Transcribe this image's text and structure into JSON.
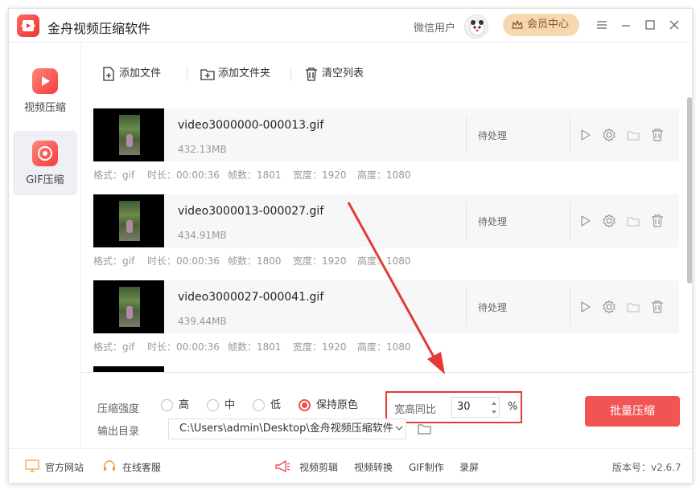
{
  "app": {
    "title": "金舟视频压缩软件",
    "user_name": "微信用户",
    "vip_label": "会员中心"
  },
  "sidebar": {
    "items": [
      {
        "label": "视频压缩",
        "icon": "video-play-icon",
        "active": false
      },
      {
        "label": "GIF压缩",
        "icon": "gif-icon",
        "active": true
      }
    ]
  },
  "toolbar": {
    "add_file": "添加文件",
    "add_folder": "添加文件夹",
    "clear_list": "清空列表"
  },
  "files": [
    {
      "name": "video3000000-000013.gif",
      "size": "432.13MB",
      "status": "待处理",
      "format": "格式：gif",
      "duration": "时长：00:00:36",
      "frames": "帧数：1801",
      "width": "宽度：1920",
      "height": "高度：1080"
    },
    {
      "name": "video3000013-000027.gif",
      "size": "434.91MB",
      "status": "待处理",
      "format": "格式：gif",
      "duration": "时长：00:00:36",
      "frames": "帧数：1800",
      "width": "宽度：1920",
      "height": "高度：1080"
    },
    {
      "name": "video3000027-000041.gif",
      "size": "439.44MB",
      "status": "待处理",
      "format": "格式：gif",
      "duration": "时长：00:00:36",
      "frames": "帧数：1801",
      "width": "宽度：1920",
      "height": "高度：1080"
    }
  ],
  "settings": {
    "strength_label": "压缩强度",
    "options": [
      {
        "label": "高",
        "selected": false
      },
      {
        "label": "中",
        "selected": false
      },
      {
        "label": "低",
        "selected": false
      },
      {
        "label": "保持原色",
        "selected": true
      }
    ],
    "ratio_label": "宽高同比",
    "ratio_value": "30",
    "ratio_unit": "%",
    "output_label": "输出目录",
    "output_path": "C:\\Users\\admin\\Desktop\\金舟视频压缩软件",
    "batch_button": "批量压缩"
  },
  "footer": {
    "website": "官方网站",
    "support": "在线客服",
    "links": [
      "视频剪辑",
      "视频转换",
      "GIF制作",
      "录屏"
    ],
    "version": "版本号：v2.6.7"
  },
  "colors": {
    "accent": "#f25454",
    "annotation": "#e53935",
    "vip_bg": "#f6d7b0"
  }
}
